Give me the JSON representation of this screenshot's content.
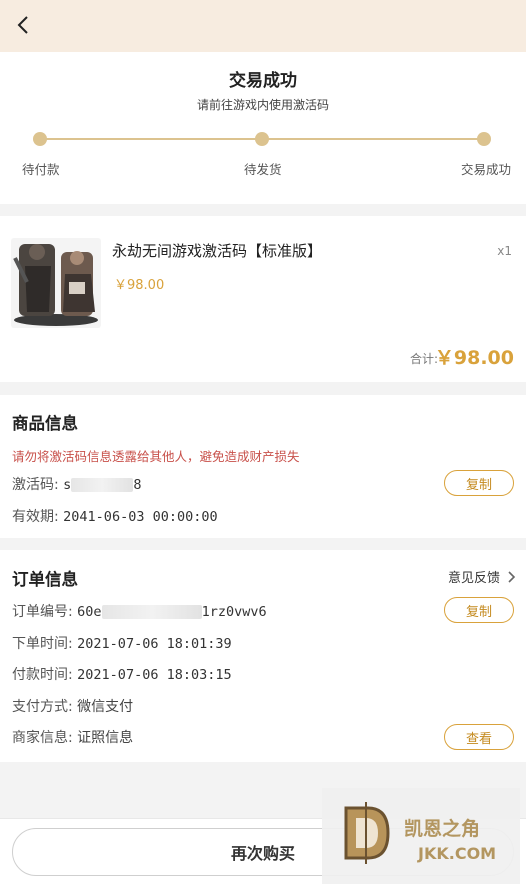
{
  "status": {
    "title": "交易成功",
    "subtitle": "请前往游戏内使用激活码",
    "steps": [
      "待付款",
      "待发货",
      "交易成功"
    ]
  },
  "product": {
    "name": "永劫无间游戏激活码【标准版】",
    "qty": "x1",
    "price": "￥98.00",
    "total_label": "合计:",
    "total_value": "￥98.00"
  },
  "goods_info": {
    "title": "商品信息",
    "warning": "请勿将激活码信息透露给其他人，避免造成财产损失",
    "code_label": "激活码:",
    "code_prefix": "s",
    "code_suffix": "8",
    "copy_label": "复制",
    "valid_label": "有效期:",
    "valid_value": "2041-06-03 00:00:00"
  },
  "order_info": {
    "title": "订单信息",
    "feedback_label": "意见反馈",
    "order_no_label": "订单编号:",
    "order_no_prefix": "60e",
    "order_no_suffix": "1rz0vwv6",
    "copy_label": "复制",
    "order_time_label": "下单时间:",
    "order_time": "2021-07-06 18:01:39",
    "pay_time_label": "付款时间:",
    "pay_time": "2021-07-06 18:03:15",
    "pay_method_label": "支付方式:",
    "pay_method": "微信支付",
    "merchant_label": "商家信息:",
    "merchant_value": "证照信息",
    "view_label": "查看"
  },
  "bottom": {
    "rebuy_label": "再次购买"
  },
  "watermark": {
    "line1": "凯恩之角",
    "line2": "JKK.COM"
  },
  "colors": {
    "accent": "#d9a23b",
    "header_bg": "#f7ece0",
    "warning": "#c8504a",
    "progress": "#dcc38f"
  },
  "icons": {
    "back": "chevron-left-icon",
    "feedback": "chevron-right-icon"
  }
}
